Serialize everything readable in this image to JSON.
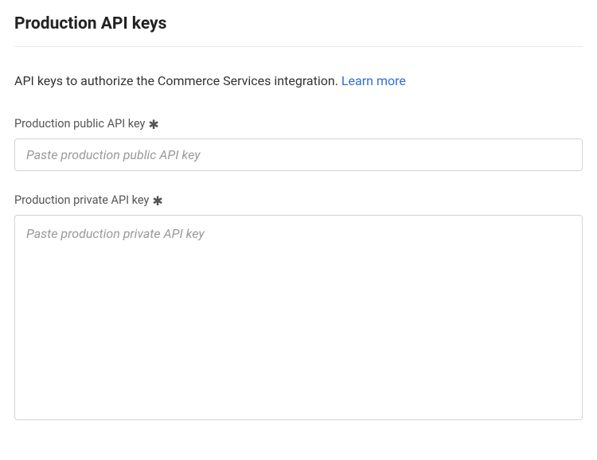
{
  "section": {
    "title": "Production API keys",
    "description_prefix": "API keys to authorize the Commerce Services integration. ",
    "learn_more_label": "Learn more"
  },
  "fields": {
    "public_key": {
      "label": "Production public API key",
      "required_mark": "✱",
      "placeholder": "Paste production public API key",
      "value": ""
    },
    "private_key": {
      "label": "Production private API key",
      "required_mark": "✱",
      "placeholder": "Paste production private API key",
      "value": ""
    }
  }
}
